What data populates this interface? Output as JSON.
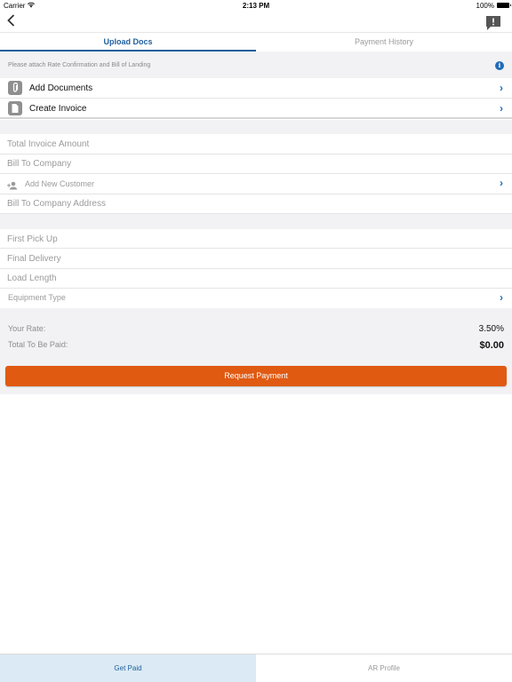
{
  "status_bar": {
    "carrier": "Carrier",
    "time": "2:13 PM",
    "battery": "100%"
  },
  "nav": {
    "back_icon": "chevron-left-icon",
    "feedback_icon": "feedback-icon"
  },
  "tabs": [
    {
      "label": "Upload Docs",
      "active": true
    },
    {
      "label": "Payment History",
      "active": false
    }
  ],
  "hint": {
    "text": "Please attach Rate Confirmation and Bill of Landing",
    "icon": "info-icon"
  },
  "documents": [
    {
      "label": "Add Documents",
      "icon": "paperclip-icon"
    },
    {
      "label": "Create Invoice",
      "icon": "document-icon"
    }
  ],
  "invoice_fields": {
    "total_invoice_amount": "Total Invoice Amount",
    "bill_to_company": "Bill To Company",
    "add_new_customer": "Add New Customer",
    "bill_to_company_address": "Bill To Company Address"
  },
  "load_fields": {
    "first_pick_up": "First Pick Up",
    "final_delivery": "Final Delivery",
    "load_length": "Load Length",
    "equipment_type": "Equipment Type"
  },
  "rate": {
    "your_rate_label": "Your Rate:",
    "your_rate_value": "3.50%",
    "total_label": "Total To Be Paid:",
    "total_value": "$0.00"
  },
  "request_button": "Request Payment",
  "bottom_tabs": [
    {
      "label": "Get Paid",
      "active": true
    },
    {
      "label": "AR Profile",
      "active": false
    }
  ],
  "colors": {
    "accent": "#1e6bb8",
    "button": "#e05a12",
    "active_tab_bg": "#dbeaf4"
  }
}
